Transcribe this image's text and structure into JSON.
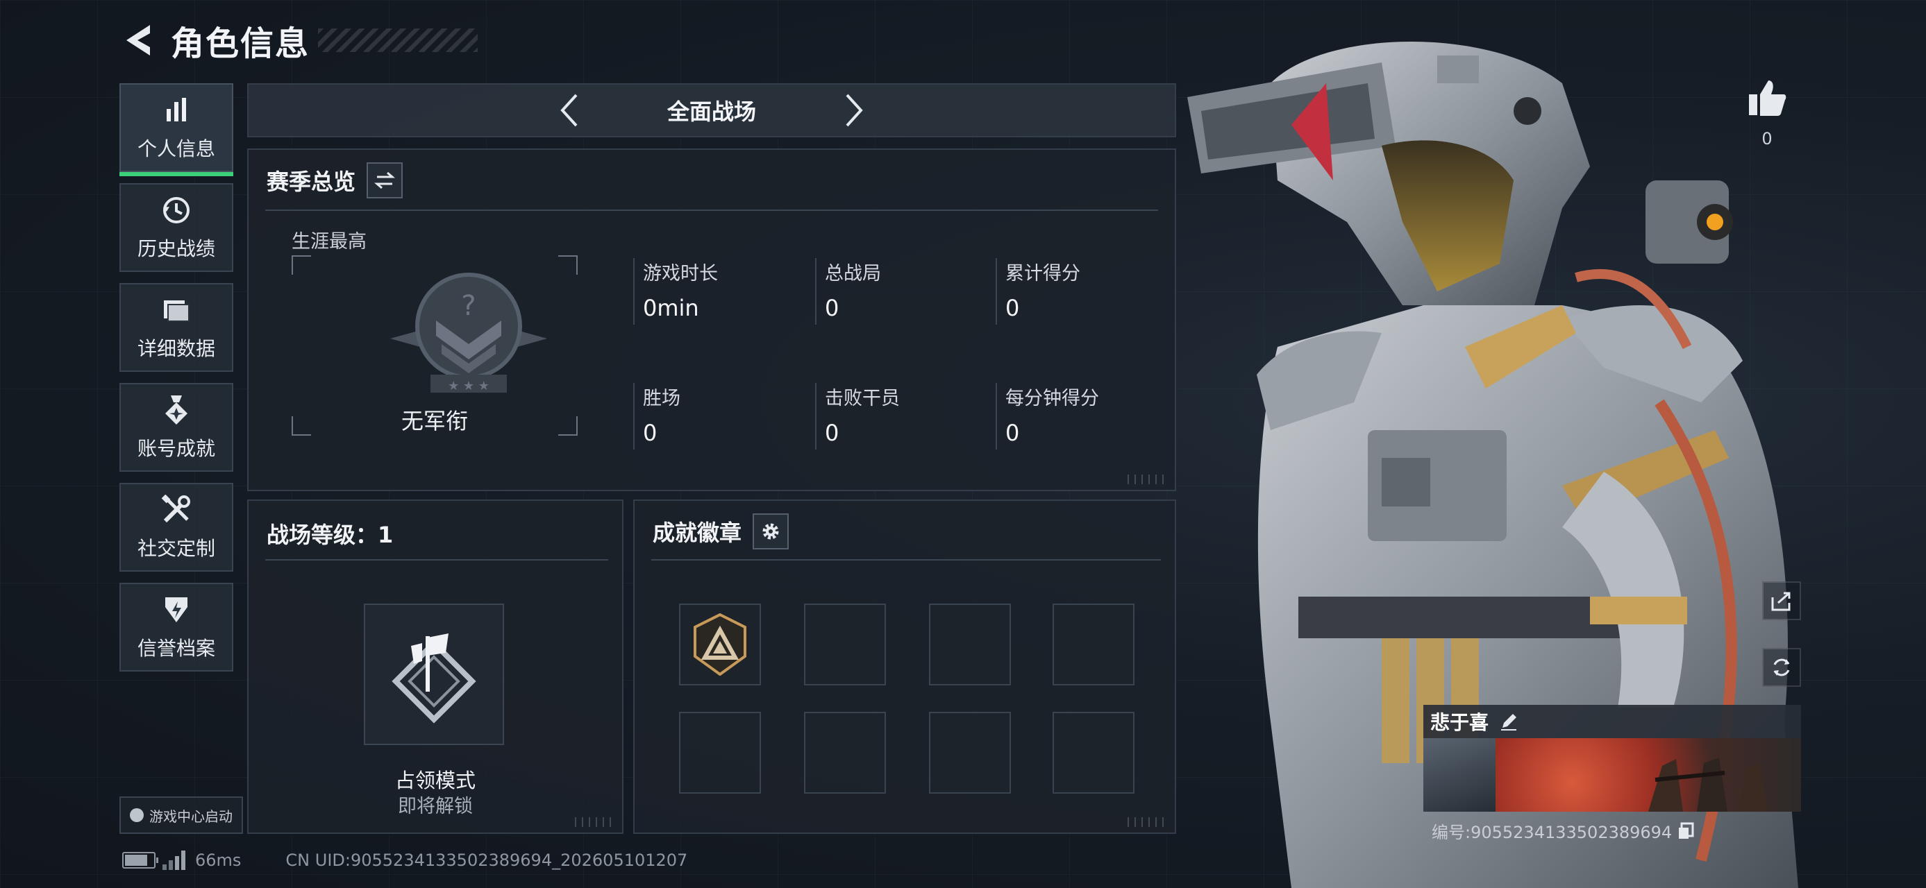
{
  "header": {
    "title": "角色信息"
  },
  "sidebar": {
    "items": [
      {
        "label": "个人信息",
        "icon": "bar-chart-icon",
        "active": true
      },
      {
        "label": "历史战绩",
        "icon": "history-clock-icon",
        "active": false
      },
      {
        "label": "详细数据",
        "icon": "folder-icon",
        "active": false
      },
      {
        "label": "账号成就",
        "icon": "medal-icon",
        "active": false
      },
      {
        "label": "社交定制",
        "icon": "tools-icon",
        "active": false
      },
      {
        "label": "信誉档案",
        "icon": "shield-icon",
        "active": false
      }
    ],
    "launch_label": "游戏中心启动"
  },
  "mode_bar": {
    "label": "全面战场"
  },
  "season": {
    "title": "赛季总览",
    "career_label": "生涯最高",
    "rank_name": "无军衔",
    "stats": [
      {
        "label": "游戏时长",
        "value": "0min"
      },
      {
        "label": "总战局",
        "value": "0"
      },
      {
        "label": "累计得分",
        "value": "0"
      },
      {
        "label": "胜场",
        "value": "0"
      },
      {
        "label": "击败干员",
        "value": "0"
      },
      {
        "label": "每分钟得分",
        "value": "0"
      }
    ]
  },
  "level": {
    "title": "战场等级：1",
    "mode_name": "占领模式",
    "mode_status": "即将解锁"
  },
  "badges": {
    "title": "成就徽章",
    "filled_count": 1
  },
  "status_bar": {
    "ping": "66ms",
    "uid": "CN UID:9055234133502389694_202605101207"
  },
  "character": {
    "likes": "0",
    "name": "悲于喜",
    "id_text": "编号:9055234133502389694"
  },
  "colors": {
    "accent_green": "#3bd17a",
    "panel_bg": "#1c222a",
    "border": "#343e4a"
  }
}
